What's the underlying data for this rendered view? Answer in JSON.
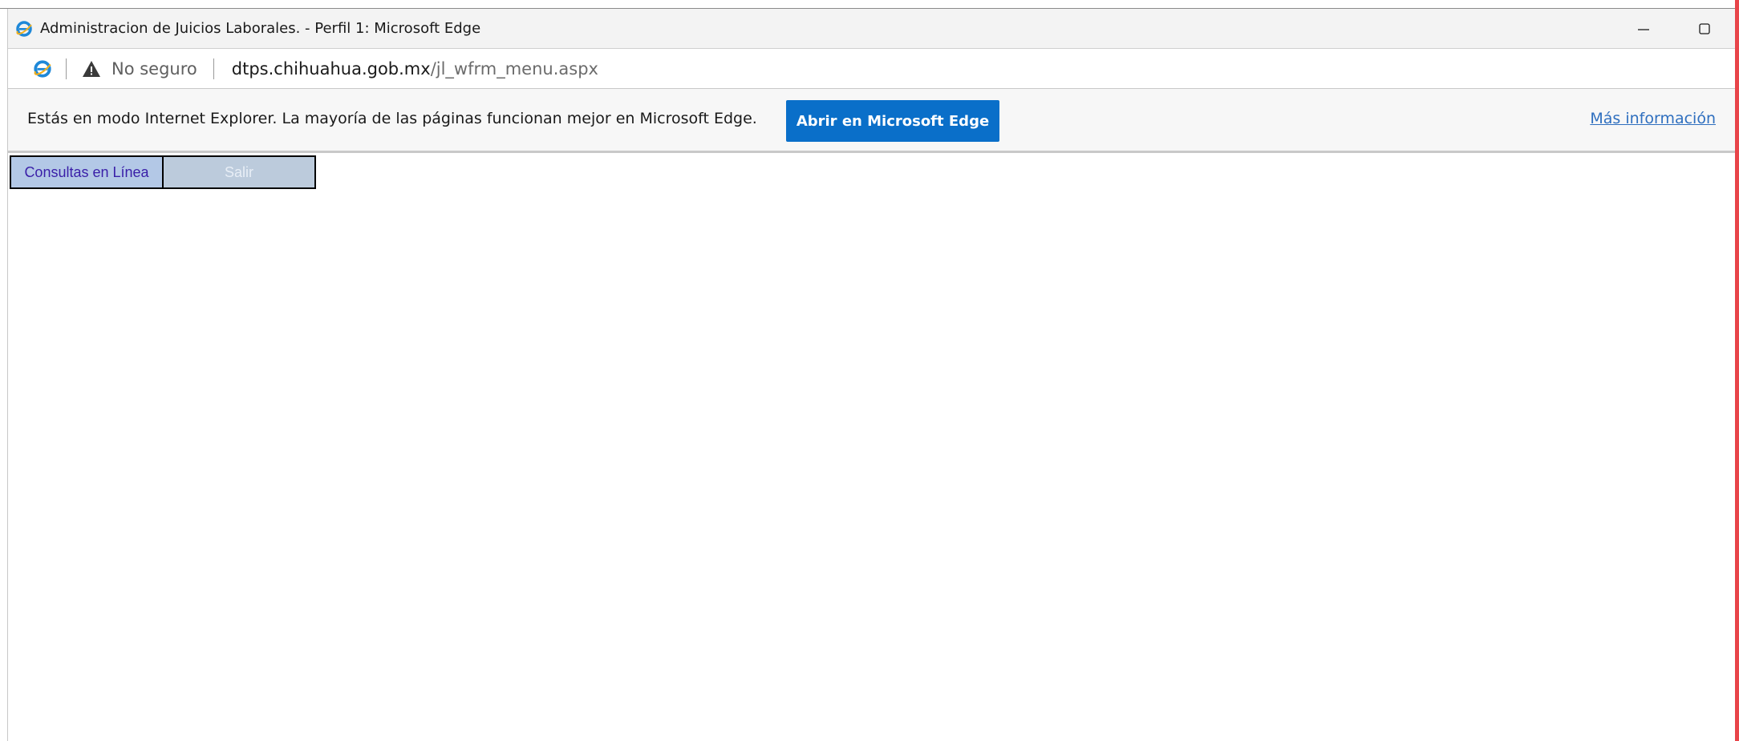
{
  "window": {
    "title": "Administracion de Juicios Laborales. - Perfil 1: Microsoft Edge",
    "controls": {
      "minimize": "minimize-icon",
      "maximize": "maximize-icon"
    }
  },
  "address_bar": {
    "security_label": "No seguro",
    "url_host": "dtps.chihuahua.gob.mx",
    "url_path": "/jl_wfrm_menu.aspx"
  },
  "ie_mode_bar": {
    "message": "Estás en modo Internet Explorer. La mayoría de las páginas funcionan mejor en Microsoft Edge.",
    "open_button_label": "Abrir en Microsoft Edge",
    "more_info_label": "Más información"
  },
  "menu": {
    "items": [
      {
        "label": "Consultas en Línea"
      },
      {
        "label": "Salir"
      }
    ]
  },
  "colors": {
    "accent_button": "#0a6fc9",
    "link": "#2f6fbf",
    "menu_bg": "#b3c8e6",
    "right_edge": "#e8454a"
  }
}
